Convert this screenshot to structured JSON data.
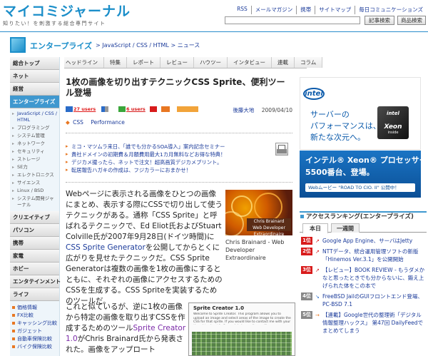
{
  "header": {
    "logo_title": "マイコミジャーナル",
    "logo_tagline": "知りたい！を刺激する総合専門サイト",
    "top_links": [
      "RSS",
      "メールマガジン",
      "携帯",
      "サイトマップ",
      "毎日コミュニケーションズ"
    ],
    "search": {
      "value": "",
      "article_button": "記事検索",
      "product_button": "商品検索"
    }
  },
  "section": {
    "title": "エンタープライズ",
    "breadcrumb": "> JavaScript / CSS / HTML > ニュース"
  },
  "leftnav": {
    "top": "総合トップ",
    "groups": [
      {
        "label": "ネット"
      },
      {
        "label": "経営"
      },
      {
        "label": "エンタープライズ",
        "active": true,
        "subs": [
          "JavaScript / CSS / HTML",
          "プログラミング",
          "システム管理",
          "ネットワーク",
          "セキュリティ",
          "ストレージ",
          "SE力",
          "エレクトロニクス",
          "サイエンス",
          "Linux / BSD",
          "システム開発ジャーナル"
        ]
      },
      {
        "label": "クリエイティブ"
      },
      {
        "label": "パソコン"
      },
      {
        "label": "携帯"
      },
      {
        "label": "家電"
      },
      {
        "label": "ホビー"
      },
      {
        "label": "エンタテインメント"
      },
      {
        "label": "ライフ"
      }
    ],
    "links": [
      "価格情報",
      "FX比較",
      "キャッシング比較",
      "ガジェット",
      "自動車保険比較",
      "バイク保険比較"
    ]
  },
  "tabs": [
    "ヘッドライン",
    "特集",
    "レポート",
    "レビュー",
    "ハウツー",
    "インタビュー",
    "連載",
    "コラム"
  ],
  "article": {
    "title": "1枚の画像を切り出すテクニックCSS Sprite、便利ツール登場",
    "bookmarks": [
      {
        "icon": "hatena-bookmark-icon",
        "count": "27 users",
        "color": "#2a6cc8"
      },
      {
        "icon": "delicious-icon",
        "count": "",
        "color": "#999"
      },
      {
        "icon": "livedoor-clip-icon",
        "count": "6 users",
        "color": "#3aa63a"
      },
      {
        "icon": "yahoo-bookmark-icon",
        "count": "",
        "color": "#d81b1b"
      },
      {
        "icon": "buzzurl-icon",
        "count": "",
        "color": "#e87722"
      },
      {
        "icon": "share-icon",
        "count": "",
        "color": "#e87722"
      }
    ],
    "author": "後藤大地",
    "date": "2009/04/10",
    "tags": [
      "CSS",
      "Performance"
    ],
    "pr_links": [
      "ミコ・マツムラ来日、「誰でも分かるSOA導入」案内記念セミナー",
      "貴社ドメインの初期費＆月額費用最大1カ月無料などお得な特典！",
      "デジカメ撮ったら、ネットで注文！超高画質デジカメプリント。",
      "転居報告ハガキの作成は、フジカラーにおまかせ！"
    ],
    "p1": [
      {
        "t": "Webページに表示される画像をひとつの画像にまとめ、表示する際にCSSで切り出して使うテクニックがある。通称「CSS Sprite」と呼ばれるテクニックで、Ed Eliot氏およびStuart Colville氏が2007年9月28日(ドイツ時間)に"
      },
      {
        "t": "CSS Sprite Generator",
        "link": true
      },
      {
        "t": "を公開してからとくに広がりを見せたテクニックだ。CSS Sprite Generatorは複数の画像を1枚の画像にするとともに、それぞれの画像にアクセスするためのCSSを生成する。CSS Spriteを実装するためのツールだ。"
      }
    ],
    "p2": [
      {
        "t": "これと似ているが、逆に1枚の画像から特定の画像を取り出すCSSを作成するためのツール"
      },
      {
        "t": "Sprite Creator 1.0",
        "link": true
      },
      {
        "t": "がChris Brainard氏から発表された。画像をアップロート"
      }
    ],
    "fig1": {
      "label": "Chris Brainard Web Developer Extraordinaire",
      "caption": "Chris Brainard - Web Developer Extraordinaire"
    },
    "fig2": {
      "heading": "Sprite Creator 1.0",
      "text": "Welcome to Sprite Creator. This program allows you to upload an image and select areas of the image to create the CSS for that sprite. If you would like to contact me with your thoughts about it: fbgenglobal@gmail.com. If you are interested in it, then you can download it from here."
    }
  },
  "ads": {
    "intel1": {
      "logo": "intel",
      "copy": [
        "サーバーの",
        "パフォーマンスは、",
        "新たな次元へ。"
      ],
      "chip_top": "intel",
      "chip_brand": "Xeon",
      "chip_sub": "inside"
    },
    "intel2": {
      "line1": "インテル® Xeon® プロセッサー",
      "line2": "5500番台、登場。",
      "button": "Webムービー \"ROAD TO CIO. II\" 公開中！"
    }
  },
  "ranking": {
    "heading": "アクセスランキング(エンタープライズ)",
    "tabs": [
      "本日",
      "一週間"
    ],
    "items": [
      {
        "rank": "1位",
        "trend": "up",
        "title": "Google App Engine、サーバはJetty"
      },
      {
        "rank": "2位",
        "trend": "up",
        "title": "NTTデータ、統合運用管理ソフトの新版「Hinemos Ver.3.1」を公開開始"
      },
      {
        "rank": "3位",
        "trend": "up",
        "title": "【レビュー】BOOK REVIEW - もうダメかなと思ったときでも分からないに、鍛え上げられた体をこの本で"
      },
      {
        "rank": "4位",
        "trend": "down",
        "title": "FreeBSD JailのGUIフロントエンド登場、PC-BSD 7.1"
      },
      {
        "rank": "5位",
        "trend": "same",
        "title": "【連載】Google世代の整理術「デジタル情報整理ハックス」 第47回 DailyFeedでまとめてしまう"
      }
    ]
  }
}
